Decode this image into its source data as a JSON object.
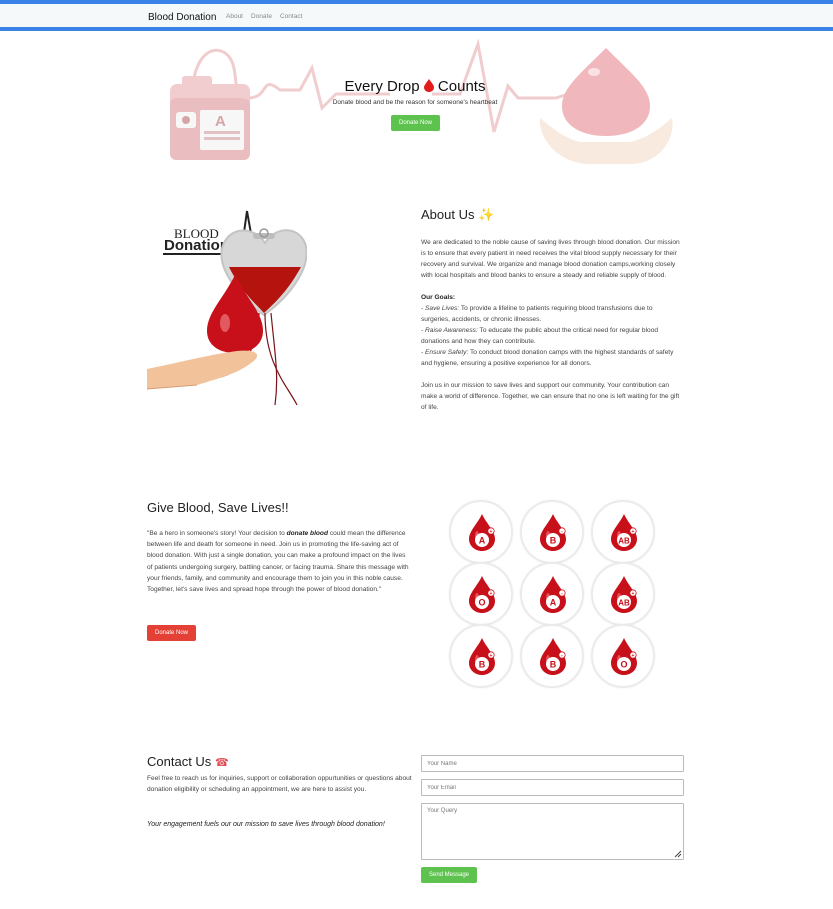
{
  "nav": {
    "brand": "Blood Donation",
    "links": [
      "About",
      "Donate",
      "Contact"
    ]
  },
  "hero": {
    "title_left": "Every Drop",
    "title_icon": "blood-drop-icon",
    "title_right": "Counts",
    "subtitle": "Donate blood and be the reason for someone's heartbeat",
    "button": "Donate Now"
  },
  "about": {
    "title": "About Us",
    "title_icon": "sparkles-icon",
    "logo_line1": "BLOOD",
    "logo_line2": "Donation",
    "intro": "We are dedicated to the noble cause of saving lives through blood donation. Our mission is to ensure that every patient in need receives the vital blood supply necessary for their recovery and survival. We organize and manage blood donation camps,working closely with local hospitals and blood banks to ensure a steady and reliable supply of blood.",
    "goals_heading": "Our Goals:",
    "goals": [
      {
        "label": "- Save Lives:",
        "text": " To provide a lifeline to patients requiring blood transfusions due to surgeries, accidents, or chronic illnesses."
      },
      {
        "label": "- Raise Awareness:",
        "text": " To educate the public about the critical need for regular blood donations and how they can contribute."
      },
      {
        "label": "- Ensure Safety:",
        "text": " To conduct blood donation camps with the highest standards of safety and hygiene, ensuring a positive experience for all donors."
      }
    ],
    "outro": "Join us in our mission to save lives and support our community. Your contribution can make a world of difference. Together, we can ensure that no one is left waiting for the gift of life."
  },
  "give": {
    "title": "Give Blood, Save Lives!!",
    "text_before": "\"Be a hero in someone's story! Your decision to ",
    "text_bold": "donate blood",
    "text_after": " could mean the difference between life and death for someone in need. Join us in promoting the life-saving act of blood donation. With just a single donation, you can make a profound impact on the lives of patients undergoing surgery, battling cancer, or facing trauma. Share this message with your friends, family, and community and encourage them to join you in this noble cause. Together, let's save lives and spread hope through the power of blood donation.\"",
    "button": "Donate Now",
    "blood_types": [
      {
        "group": "A",
        "sign": "+"
      },
      {
        "group": "B",
        "sign": "-"
      },
      {
        "group": "AB",
        "sign": "+"
      },
      {
        "group": "O",
        "sign": "+"
      },
      {
        "group": "A",
        "sign": "-"
      },
      {
        "group": "AB",
        "sign": "+"
      },
      {
        "group": "B",
        "sign": "+"
      },
      {
        "group": "B",
        "sign": "-"
      },
      {
        "group": "O",
        "sign": "+"
      }
    ]
  },
  "contact": {
    "title": "Contact Us",
    "title_icon": "telephone-icon",
    "text": "Feel free to reach us for inquiries, support or collaboration oppurtunities or questions about donation eligibility or scheduling an appointment, we are here to assist you.",
    "note": "Your engagement fuels our our mission to save lives through blood donation!",
    "name_placeholder": "Your Name",
    "email_placeholder": "Your Email",
    "query_placeholder": "Your Query",
    "button": "Send Message"
  },
  "colors": {
    "accent_blue": "#3a83e6",
    "green": "#5ec24e",
    "red_button": "#e44036",
    "blood_red": "#c8101a"
  }
}
